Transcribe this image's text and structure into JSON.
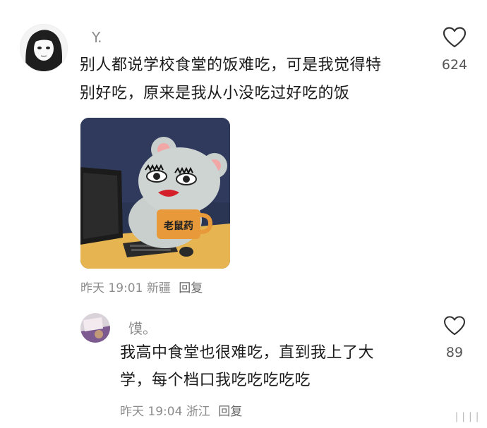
{
  "comments": [
    {
      "username": "Y.",
      "text_line1": "别人都说学校食堂的饭难吃，可是我觉得特",
      "text_line2": "别好吃，原来是我从小没吃过好吃的饭",
      "sticker_text": "老鼠药",
      "time": "昨天 19:01",
      "location": "新疆",
      "reply_label": "回复",
      "likes": "624"
    },
    {
      "username": "馍。",
      "text_line1": "我高中食堂也很难吃，直到我上了大",
      "text_line2": "学，每个档口我吃吃吃吃吃",
      "time": "昨天 19:04",
      "location": "浙江",
      "reply_label": "回复",
      "likes": "89"
    }
  ],
  "watermark": "❘❘❘❘"
}
